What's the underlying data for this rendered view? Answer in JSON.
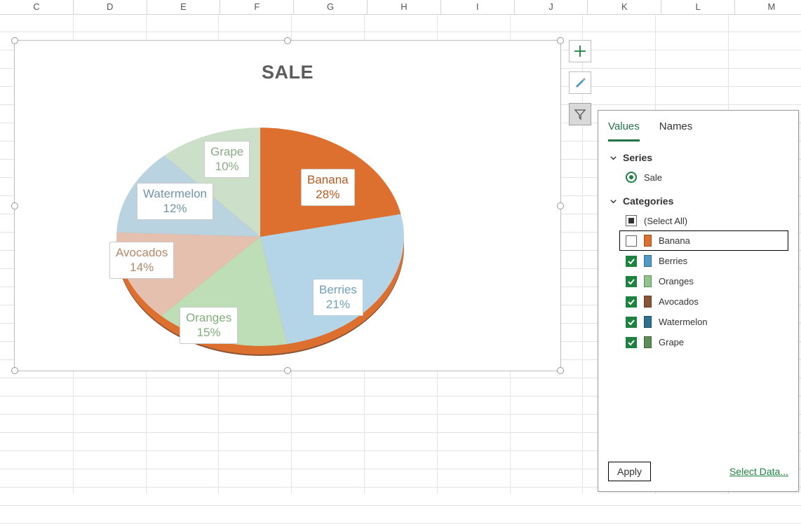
{
  "columns": [
    "C",
    "D",
    "E",
    "F",
    "G",
    "H",
    "I",
    "J",
    "K",
    "L",
    "M"
  ],
  "chart": {
    "title": "SALE",
    "labels": {
      "banana": "Banana\n28%",
      "berries": "Berries\n21%",
      "oranges": "Oranges\n15%",
      "avocados": "Avocados\n14%",
      "watermelon": "Watermelon\n12%",
      "grape": "Grape\n10%"
    },
    "colors": {
      "banana": "#DD6F2F",
      "berries": "#B4D5E8",
      "oranges": "#BDDEB7",
      "avocados": "#E6C0AE",
      "watermelon": "#B9D3E1",
      "grape": "#CCDFC8"
    }
  },
  "filter": {
    "tabs": {
      "values": "Values",
      "names": "Names"
    },
    "series_header": "Series",
    "series_item": "Sale",
    "categories_header": "Categories",
    "select_all": "(Select All)",
    "items": [
      {
        "key": "banana",
        "label": "Banana",
        "checked": false,
        "swatch": "#DD6F2F"
      },
      {
        "key": "berries",
        "label": "Berries",
        "checked": true,
        "swatch": "#4F9AC6"
      },
      {
        "key": "oranges",
        "label": "Oranges",
        "checked": true,
        "swatch": "#8FC48A"
      },
      {
        "key": "avocados",
        "label": "Avocados",
        "checked": true,
        "swatch": "#8A5436"
      },
      {
        "key": "watermelon",
        "label": "Watermelon",
        "checked": true,
        "swatch": "#2F6F90"
      },
      {
        "key": "grape",
        "label": "Grape",
        "checked": true,
        "swatch": "#5E8E58"
      }
    ],
    "apply": "Apply",
    "select_data": "Select Data..."
  },
  "chart_data": {
    "type": "pie",
    "title": "SALE",
    "series_name": "Sale",
    "categories": [
      "Banana",
      "Berries",
      "Oranges",
      "Avocados",
      "Watermelon",
      "Grape"
    ],
    "values": [
      28,
      21,
      15,
      14,
      12,
      10
    ],
    "unit": "percent",
    "colors": [
      "#DD6F2F",
      "#B4D5E8",
      "#BDDEB7",
      "#E6C0AE",
      "#B9D3E1",
      "#CCDFC8"
    ]
  }
}
